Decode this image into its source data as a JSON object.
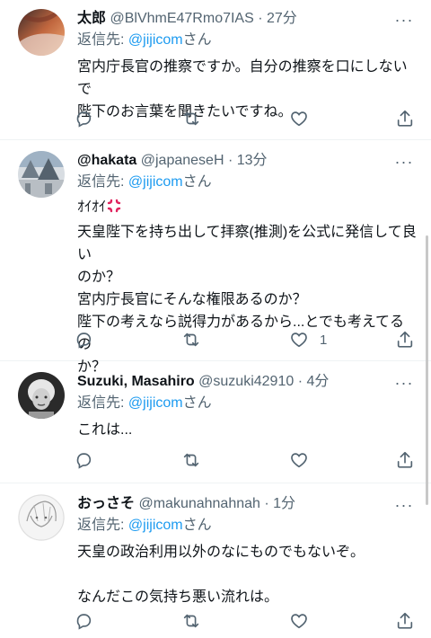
{
  "tweets": [
    {
      "name": "太郎",
      "handle": "@BlVhmE47Rmo7IAS",
      "sep": " · ",
      "time": "27分",
      "reply_prefix": "返信先: ",
      "reply_mention": "@jijicom",
      "reply_suffix": "さん",
      "text": "宮内庁長官の推察ですか。自分の推察を口にしないで\n陛下のお言葉を聞きたいですね。",
      "like_count": ""
    },
    {
      "name": "@hakata",
      "handle": "@japaneseH",
      "sep": " · ",
      "time": "13分",
      "reply_prefix": "返信先: ",
      "reply_mention": "@jijicom",
      "reply_suffix": "さん",
      "text_prefix": "ｵｲｵｲ",
      "text": "天皇陛下を持ち出して拝察(推測)を公式に発信して良い\nのか？\n宮内庁長官にそんな権限あるのか？\n陛下の考えなら説得力があるから...とでも考えてるの\nか？",
      "like_count": "1"
    },
    {
      "name": "Suzuki, Masahiro",
      "handle": "@suzuki42910",
      "sep": " · ",
      "time": "4分",
      "reply_prefix": "返信先: ",
      "reply_mention": "@jijicom",
      "reply_suffix": "さん",
      "text": "これは...",
      "like_count": ""
    },
    {
      "name": "おっさそ",
      "handle": "@makunahnahnah",
      "sep": " · ",
      "time": "1分",
      "reply_prefix": "返信先: ",
      "reply_mention": "@jijicom",
      "reply_suffix": "さん",
      "text": "天皇の政治利用以外のなにものでもないぞ。\n\nなんだこの気持ち悪い流れは。",
      "like_count": ""
    }
  ],
  "icons": {
    "more": "more-icon",
    "reply": "reply-icon",
    "retweet": "retweet-icon",
    "like": "like-icon",
    "share": "share-icon"
  },
  "colors": {
    "text": "#0f1419",
    "secondary": "#536471",
    "link": "#1d9bf0",
    "divider": "#eff3f4",
    "anger": "#e0245e"
  }
}
